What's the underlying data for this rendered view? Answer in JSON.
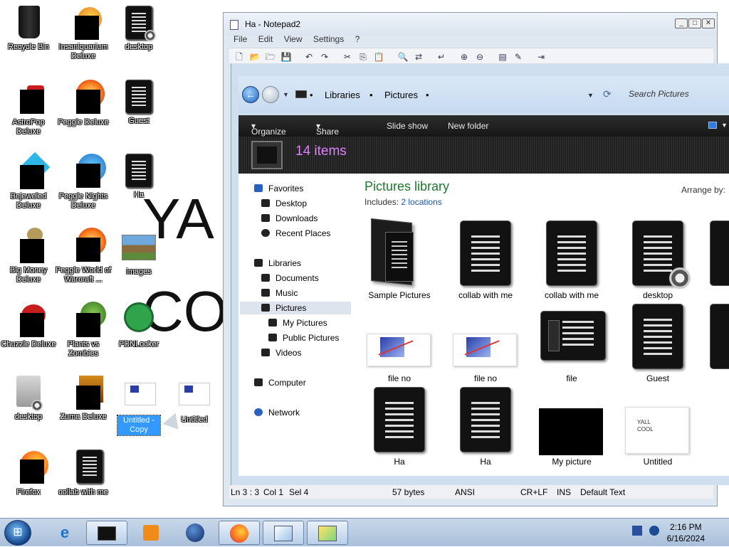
{
  "desktop": {
    "icons": [
      {
        "label": "Recycle Bin"
      },
      {
        "label": "Insaniquarium Deluxe"
      },
      {
        "label": "desktop"
      },
      {
        "label": "AstroPop Deluxe"
      },
      {
        "label": "Peggle Deluxe"
      },
      {
        "label": "Guest"
      },
      {
        "label": "Bejeweled Deluxe"
      },
      {
        "label": "Peggle Nights Deluxe"
      },
      {
        "label": "Ha"
      },
      {
        "label": "Big Money Deluxe"
      },
      {
        "label": "Peggle World of Warcraft ..."
      },
      {
        "label": "images"
      },
      {
        "label": "Chuzzle Deluxe"
      },
      {
        "label": "Plants vs Zombies"
      },
      {
        "label": "PDNLocker"
      },
      {
        "label": "desktop"
      },
      {
        "label": "Zuma Deluxe"
      },
      {
        "label": "Untitled - Copy"
      },
      {
        "label": "Untitled"
      },
      {
        "label": "Firefox"
      },
      {
        "label": "collab with me"
      }
    ],
    "big_text_1": "YA",
    "big_text_2": "CO"
  },
  "notepad": {
    "title": "Ha - Notepad2",
    "menu": [
      "File",
      "Edit",
      "View",
      "Settings",
      "?"
    ],
    "status": {
      "position": "Ln 3 : 3",
      "col": "Col 1",
      "sel": "Sel 4",
      "size": "57 bytes",
      "encoding": "ANSI",
      "eol": "CR+LF",
      "ins": "INS",
      "scheme": "Default Text"
    }
  },
  "explorer": {
    "breadcrumb": [
      "Libraries",
      "Pictures"
    ],
    "search_placeholder": "Search Pictures",
    "commands": [
      "Organize",
      "Share with",
      "Slide show",
      "New folder"
    ],
    "item_count": "14 items",
    "nav": {
      "favorites": "Favorites",
      "desktop": "Desktop",
      "downloads": "Downloads",
      "recent": "Recent Places",
      "libraries": "Libraries",
      "documents": "Documents",
      "music": "Music",
      "pictures": "Pictures",
      "my_pictures": "My Pictures",
      "public_pictures": "Public Pictures",
      "videos": "Videos",
      "computer": "Computer",
      "network": "Network"
    },
    "library_title": "Pictures library",
    "includes_label": "Includes:",
    "includes_link": "2 locations",
    "arrange_label": "Arrange by:",
    "items": [
      {
        "label": "Sample Pictures"
      },
      {
        "label": "collab with me"
      },
      {
        "label": "collab with me"
      },
      {
        "label": "desktop"
      },
      {
        "label": "file no"
      },
      {
        "label": "file no"
      },
      {
        "label": "file"
      },
      {
        "label": "Guest"
      },
      {
        "label": "Ha"
      },
      {
        "label": "Ha"
      },
      {
        "label": "My picture"
      },
      {
        "label": "Untitled"
      }
    ],
    "untitled_thumb_text": [
      "YALL",
      "COOL"
    ]
  },
  "taskbar": {
    "time": "2:16 PM",
    "date": "6/16/2024"
  }
}
